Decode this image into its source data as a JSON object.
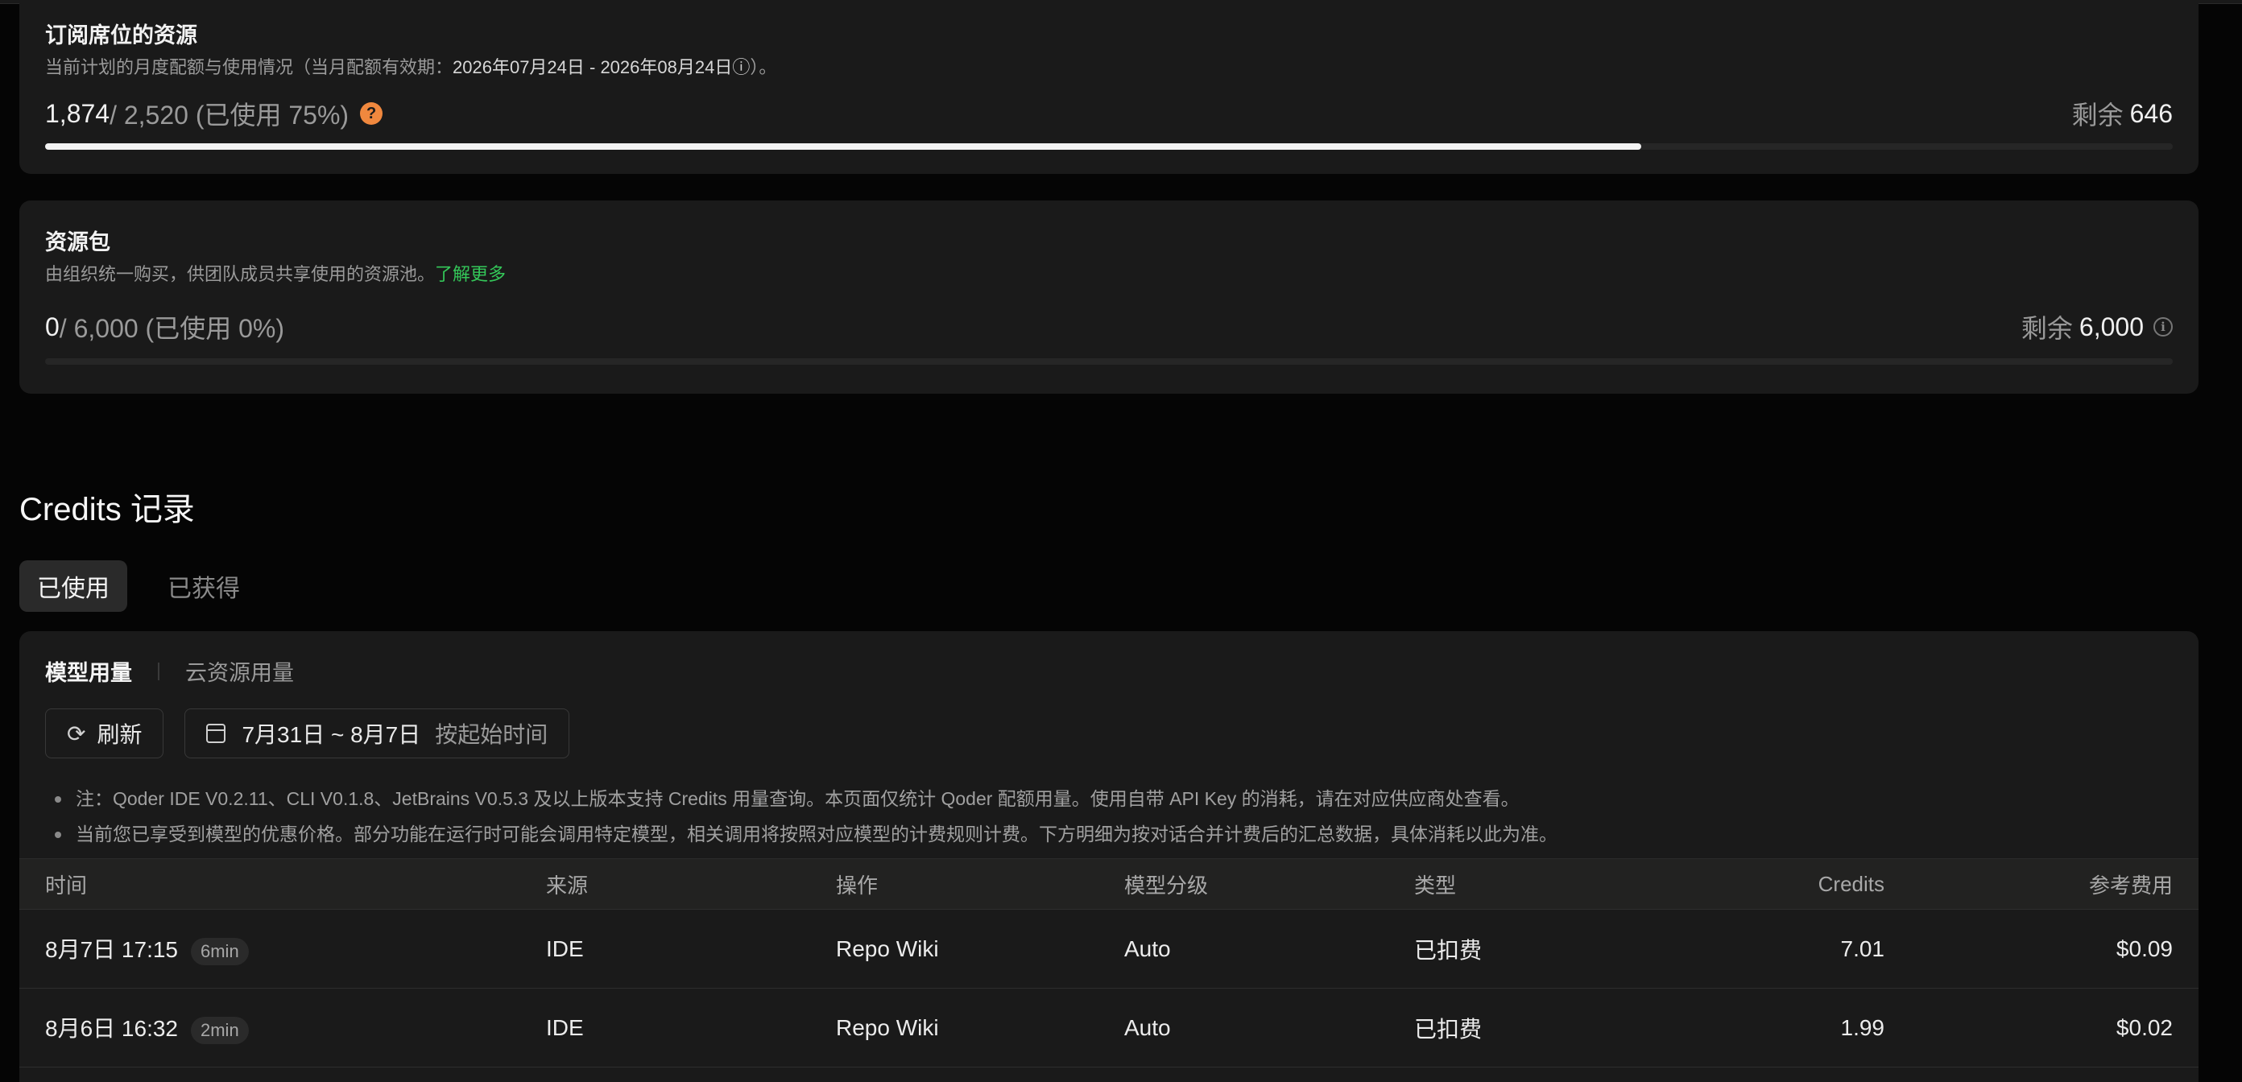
{
  "subscription": {
    "title": "订阅席位的资源",
    "desc": "当前计划的月度配额与使用情况（当月配额有效期：",
    "period": "2026年07月24日 - 2026年08月24日",
    "desc_tail": "）。",
    "used": "1,874",
    "total": " / 2,520 (已使用 75%)",
    "help": "?",
    "remain_label": "剩余",
    "remain_value": "646",
    "progress": 0.75
  },
  "package": {
    "title": "资源包",
    "desc": "由组织统一购买，供团队成员共享使用的资源池。",
    "link": "了解更多",
    "used": "0",
    "total": " / 6,000 (已使用 0%)",
    "remain_label": "剩余",
    "remain_value": "6,000",
    "progress": 0
  },
  "records": {
    "title": "Credits 记录",
    "tabs": [
      "已使用",
      "已获得"
    ],
    "subtabs": [
      "模型用量",
      "云资源用量"
    ],
    "refresh_label": "刷新",
    "date_range": "7月31日 ~ 8月7日",
    "date_hint": "按起始时间",
    "notes": [
      "注：Qoder IDE V0.2.11、CLI V0.1.8、JetBrains V0.5.3 及以上版本支持 Credits 用量查询。本页面仅统计 Qoder 配额用量。使用自带 API Key 的消耗，请在对应供应商处查看。",
      "当前您已享受到模型的优惠价格。部分功能在运行时可能会调用特定模型，相关调用将按照对应模型的计费规则计费。下方明细为按对话合并计费后的汇总数据，具体消耗以此为准。"
    ],
    "columns": [
      "时间",
      "来源",
      "操作",
      "模型分级",
      "类型",
      "Credits",
      "参考费用"
    ],
    "rows": [
      {
        "time": "8月7日 17:15",
        "duration": "6min",
        "source": "IDE",
        "op": "Repo Wiki",
        "tier": "Auto",
        "type": "已扣费",
        "credits": "7.01",
        "cost": "$0.09"
      },
      {
        "time": "8月6日 16:32",
        "duration": "2min",
        "source": "IDE",
        "op": "Repo Wiki",
        "tier": "Auto",
        "type": "已扣费",
        "credits": "1.99",
        "cost": "$0.02"
      }
    ]
  }
}
